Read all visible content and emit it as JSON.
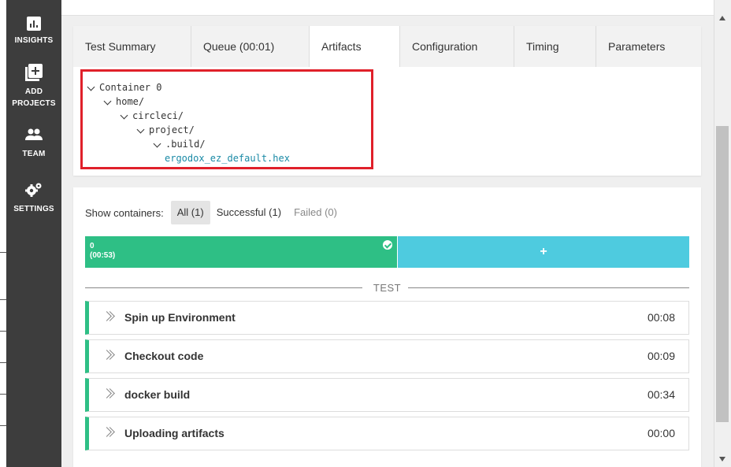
{
  "sidebar": {
    "items": [
      {
        "label_lines": [
          "INSIGHTS"
        ],
        "icon": "insights-icon"
      },
      {
        "label_lines": [
          "ADD",
          "PROJECTS"
        ],
        "icon": "add-projects-icon"
      },
      {
        "label_lines": [
          "TEAM"
        ],
        "icon": "team-icon"
      },
      {
        "label_lines": [
          "SETTINGS"
        ],
        "icon": "settings-icon"
      }
    ]
  },
  "tabs": [
    {
      "label": "Test Summary"
    },
    {
      "label": "Queue (00:01)"
    },
    {
      "label": "Artifacts",
      "active": true
    },
    {
      "label": "Configuration"
    },
    {
      "label": "Timing"
    },
    {
      "label": "Parameters"
    }
  ],
  "artifacts": {
    "tree": [
      "Container 0",
      "home/",
      "circleci/",
      "project/",
      ".build/"
    ],
    "file": "ergodox_ez_default.hex"
  },
  "filters": {
    "label": "Show containers:",
    "all": "All (1)",
    "successful": "Successful (1)",
    "failed": "Failed (0)"
  },
  "containers": {
    "index": "0",
    "duration": "(00:53)",
    "add_label": "+"
  },
  "section_label": "TEST",
  "steps": [
    {
      "name": "Spin up Environment",
      "time": "00:08"
    },
    {
      "name": "Checkout code",
      "time": "00:09"
    },
    {
      "name": "docker build",
      "time": "00:34"
    },
    {
      "name": "Uploading artifacts",
      "time": "00:00"
    }
  ],
  "colors": {
    "success": "#2ebf85",
    "container_add": "#4ecbdf",
    "highlight": "#e0202a",
    "sidebar": "#3d3d3d",
    "link": "#1a8aa6"
  }
}
